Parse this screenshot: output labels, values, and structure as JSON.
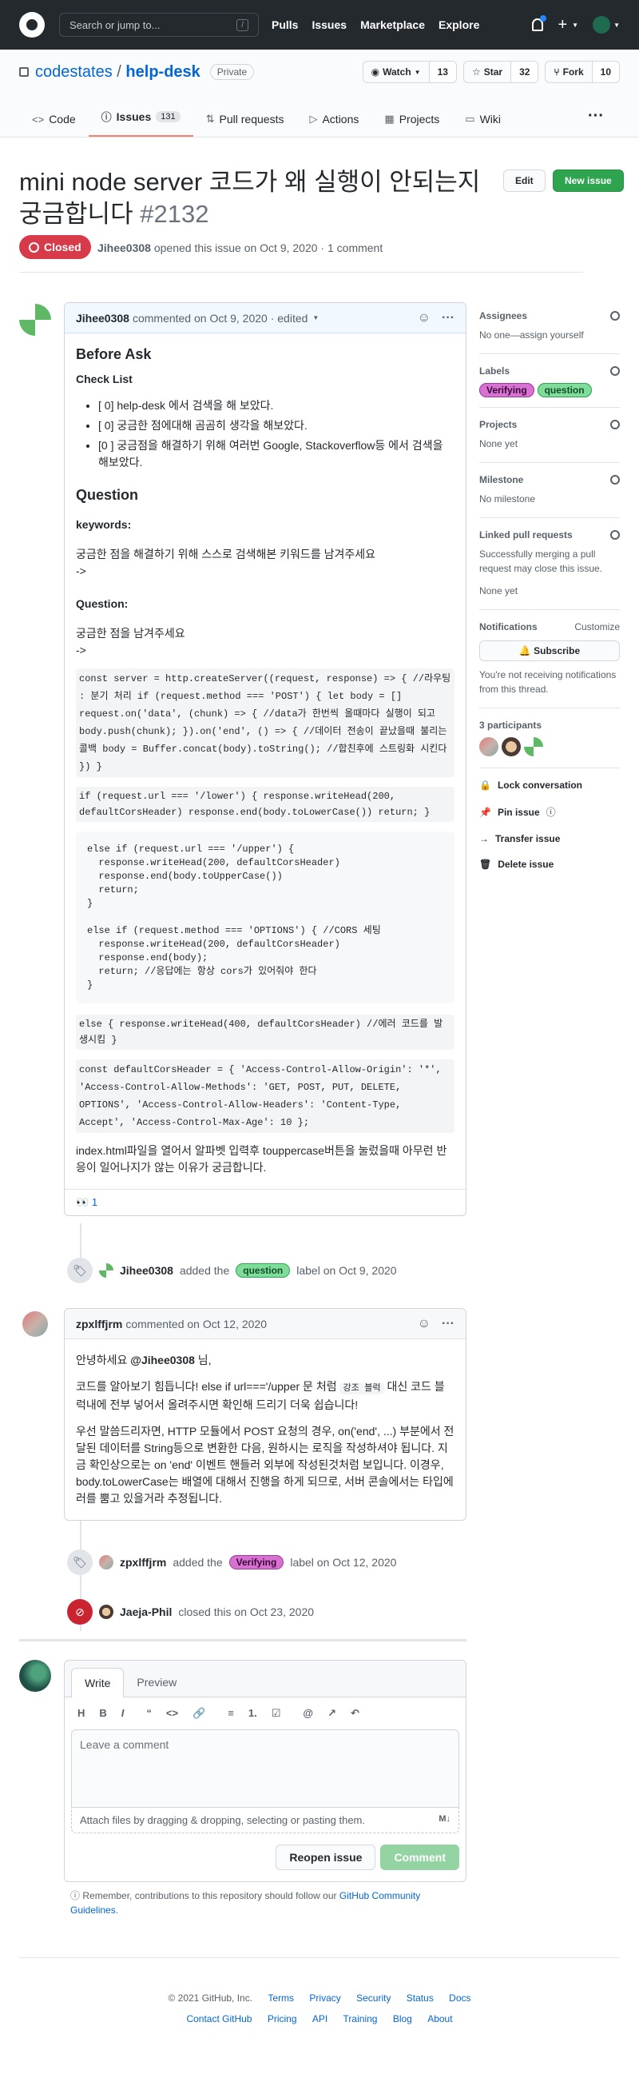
{
  "topbar": {
    "search_placeholder": "Search or jump to...",
    "slash": "/",
    "nav": [
      "Pulls",
      "Issues",
      "Marketplace",
      "Explore"
    ],
    "plus": "+"
  },
  "repo": {
    "owner": "codestates",
    "sep": "/",
    "name": "help-desk",
    "visibility": "Private",
    "watch_label": "Watch",
    "watch_count": "13",
    "star_label": "Star",
    "star_count": "32",
    "fork_label": "Fork",
    "fork_count": "10",
    "tabs": [
      {
        "label": "Code",
        "icon": "<>"
      },
      {
        "label": "Issues",
        "count": "131"
      },
      {
        "label": "Pull requests"
      },
      {
        "label": "Actions"
      },
      {
        "label": "Projects"
      },
      {
        "label": "Wiki"
      }
    ],
    "more": "···"
  },
  "issue": {
    "title": "mini node server 코드가 왜 실행이 안되는지 궁금합니다",
    "number": "#2132",
    "state": "Closed",
    "author": "Jihee0308",
    "meta": "opened this issue on Oct 9, 2020 · 1 comment",
    "edit_label": "Edit",
    "new_label": "New issue"
  },
  "comment1": {
    "author": "Jihee0308",
    "meta": "commented on Oct 9, 2020 · edited",
    "before_ask": "Before Ask",
    "checklist_title": "Check List",
    "checklist": [
      "[ 0] help-desk 에서 검색을 해 보았다.",
      "[ 0] 궁금한 점에대해 곰곰히 생각을 해보았다.",
      "[0 ] 궁금점을 해결하기 위해 여러번 Google, Stackoverflow등 에서 검색을 해보았다."
    ],
    "question_h": "Question",
    "keywords_h": "keywords:",
    "keywords_desc": "궁금한 점을 해결하기 위해 스스로 검색해본 키워드를 남겨주세요",
    "arrow1": "->",
    "question_sub": "Question:",
    "question_desc": "궁금한 점을 남겨주세요",
    "arrow2": "->",
    "code1": "const server = http.createServer((request, response) => { //라우팅 : 분기 처리 if (request.method === 'POST') { let body = [] request.on('data', (chunk) => { //data가 한번씩 올때마다 실행이 되고 body.push(chunk); }).on('end', () => { //데이터 전송이 끝났을때 불리는 콜백 body = Buffer.concat(body).toString(); //합친후에 스트링화 시킨다 }) }",
    "code2": "if (request.url === '/lower') { response.writeHead(200, defaultCorsHeader) response.end(body.toLowerCase()) return; }",
    "pre": "else if (request.url === '/upper') {\n  response.writeHead(200, defaultCorsHeader)\n  response.end(body.toUpperCase())\n  return;\n}\n\nelse if (request.method === 'OPTIONS') { //CORS 세팅\n  response.writeHead(200, defaultCorsHeader)\n  response.end(body);\n  return; //응답에는 항상 cors가 있어줘야 한다\n}",
    "code3": "else { response.writeHead(400, defaultCorsHeader) //에러 코드를 발생시킴 }",
    "code4": "const defaultCorsHeader = { 'Access-Control-Allow-Origin': '*', 'Access-Control-Allow-Methods': 'GET, POST, PUT, DELETE, OPTIONS', 'Access-Control-Allow-Headers': 'Content-Type, Accept', 'Access-Control-Max-Age': 10 };",
    "closing": "index.html파일을 열어서 알파벳 입력후 touppercase버튼을 눌렀을때 아무런 반응이 일어나지가 않는 이유가 궁금합니다.",
    "reaction_emoji": "👀",
    "reaction_count": "1"
  },
  "event1": {
    "user": "Jihee0308",
    "pre": "added the",
    "label": "question",
    "post": "label on Oct 9, 2020"
  },
  "comment2": {
    "author": "zpxlffjrm",
    "meta": "commented on Oct 12, 2020",
    "greeting_pre": "안녕하세요",
    "mention": "@Jihee0308",
    "greeting_post": "님,",
    "p1_a": "코드를 알아보기 힘듭니다! else if url==='/upper 문 처럼",
    "p1_code": "강조 블럭",
    "p1_b": "대신 코드 블럭내에 전부 넣어서 올려주시면 확인해 드리기 더욱 쉽습니다!",
    "p2": "우선 말씀드리자면, HTTP 모듈에서 POST 요청의 경우, on('end', ...) 부분에서 전달된 데이터를 String등으로 변환한 다음, 원하시는 로직을 작성하셔야 됩니다. 지금 확인상으로는 on 'end' 이벤트 핸들러 외부에 작성된것처럼 보입니다. 이경우, body.toLowerCase는 배열에 대해서 진행을 하게 되므로, 서버 콘솔에서는 타입에러를 뿜고 있을거라 추정됩니다."
  },
  "event2": {
    "user": "zpxlffjrm",
    "pre": "added the",
    "label": "Verifying",
    "post": "label on Oct 12, 2020"
  },
  "event3": {
    "user": "Jaeja-Phil",
    "text": "closed this on Oct 23, 2020"
  },
  "sidebar": {
    "assignees_h": "Assignees",
    "assignees_v": "No one—assign yourself",
    "labels_h": "Labels",
    "labels": [
      "Verifying",
      "question"
    ],
    "projects_h": "Projects",
    "projects_v": "None yet",
    "milestone_h": "Milestone",
    "milestone_v": "No milestone",
    "linked_h": "Linked pull requests",
    "linked_desc": "Successfully merging a pull request may close this issue.",
    "linked_v": "None yet",
    "notif_h": "Notifications",
    "customize": "Customize",
    "subscribe": "Subscribe",
    "notif_desc": "You're not receiving notifications from this thread.",
    "participants_h": "3 participants",
    "actions": [
      "Lock conversation",
      "Pin issue",
      "Transfer issue",
      "Delete issue"
    ]
  },
  "form": {
    "tab_write": "Write",
    "tab_preview": "Preview",
    "tools": [
      "H",
      "B",
      "I",
      "“",
      "<>",
      "🔗",
      "≡",
      "1.",
      "☑",
      "@",
      "↗",
      "↶"
    ],
    "placeholder": "Leave a comment",
    "attach": "Attach files by dragging & dropping, selecting or pasting them.",
    "md": "M↓",
    "reopen": "Reopen issue",
    "comment": "Comment",
    "note_pre": "Remember, contributions to this repository should follow our",
    "note_link": "GitHub Community Guidelines",
    "note_post": "."
  },
  "footer": {
    "copyright": "© 2021 GitHub, Inc.",
    "row1": [
      "Terms",
      "Privacy",
      "Security",
      "Status",
      "Docs"
    ],
    "row2": [
      "Contact GitHub",
      "Pricing",
      "API",
      "Training",
      "Blog",
      "About"
    ]
  },
  "colors": {
    "closed": "#d73a49",
    "green": "#2ea44f",
    "link": "#0366d6",
    "question": "#7fdc9b",
    "verifying": "#d772d2"
  }
}
